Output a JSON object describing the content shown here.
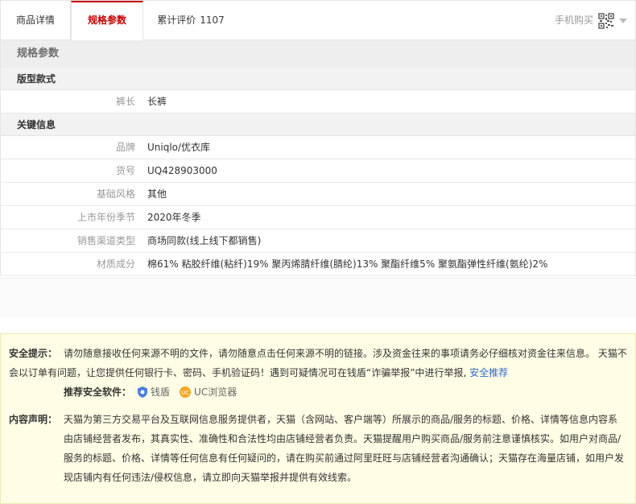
{
  "tabs": [
    {
      "label": "商品详情"
    },
    {
      "label": "规格参数"
    },
    {
      "label": "累计评价",
      "count": "1107"
    }
  ],
  "mobile_buy": "手机购买",
  "specs": {
    "title": "规格参数",
    "groups": [
      {
        "title": "版型款式",
        "rows": [
          {
            "k": "裤长",
            "v": "长裤"
          }
        ]
      },
      {
        "title": "关键信息",
        "rows": [
          {
            "k": "品牌",
            "v": "Uniqlo/优衣库"
          },
          {
            "k": "货号",
            "v": "UQ428903000"
          },
          {
            "k": "基础风格",
            "v": "其他"
          },
          {
            "k": "上市年份季节",
            "v": "2020年冬季"
          },
          {
            "k": "销售渠道类型",
            "v": "商场同款(线上线下都销售)"
          },
          {
            "k": "材质成分",
            "v": "棉61% 粘胶纤维(粘纤)19% 聚丙烯腈纤维(腈纶)13% 聚酯纤维5% 聚氨酯弹性纤维(氨纶)2%"
          }
        ]
      }
    ]
  },
  "notice": {
    "safety_label": "安全提示：",
    "safety_line1": "请勿随意接收任何来源不明的文件，请勿随意点击任何来源不明的链接。涉及资金往来的事项请务必仔细核对资金往来信息。 天猫不",
    "safety_line2": "会以订单有问题，让您提供任何银行卡、密码、手机验证码！遇到可疑情况可在钱盾“诈骗举报”中进行举报, ",
    "safety_link": "安全推荐",
    "software_label": "推荐安全软件：",
    "software": [
      "钱盾",
      "UC浏览器"
    ],
    "content_label": "内容声明：",
    "content_lines": [
      "天猫为第三方交易平台及互联网信息服务提供者，天猫（含网站、客户端等）所展示的商品/服务的标题、价格、详情等信息内容系",
      "由店铺经营者发布，其真实性、准确性和合法性均由店铺经营者负责。天猫提醒用户购买商品/服务前注意谨慎核实。如用户对商品/",
      "服务的标题、价格、详情等任何信息有任何疑问的，请在购买前通过阿里旺旺与店铺经营者沟通确认；天猫存在海量店铺，如用户发",
      "现店铺内有任何违法/侵权信息，请立即向天猫举报并提供有效线索。"
    ]
  },
  "colors": {
    "accent": "#c40000",
    "link": "#3366cc",
    "notice_bg": "#fffde5"
  }
}
